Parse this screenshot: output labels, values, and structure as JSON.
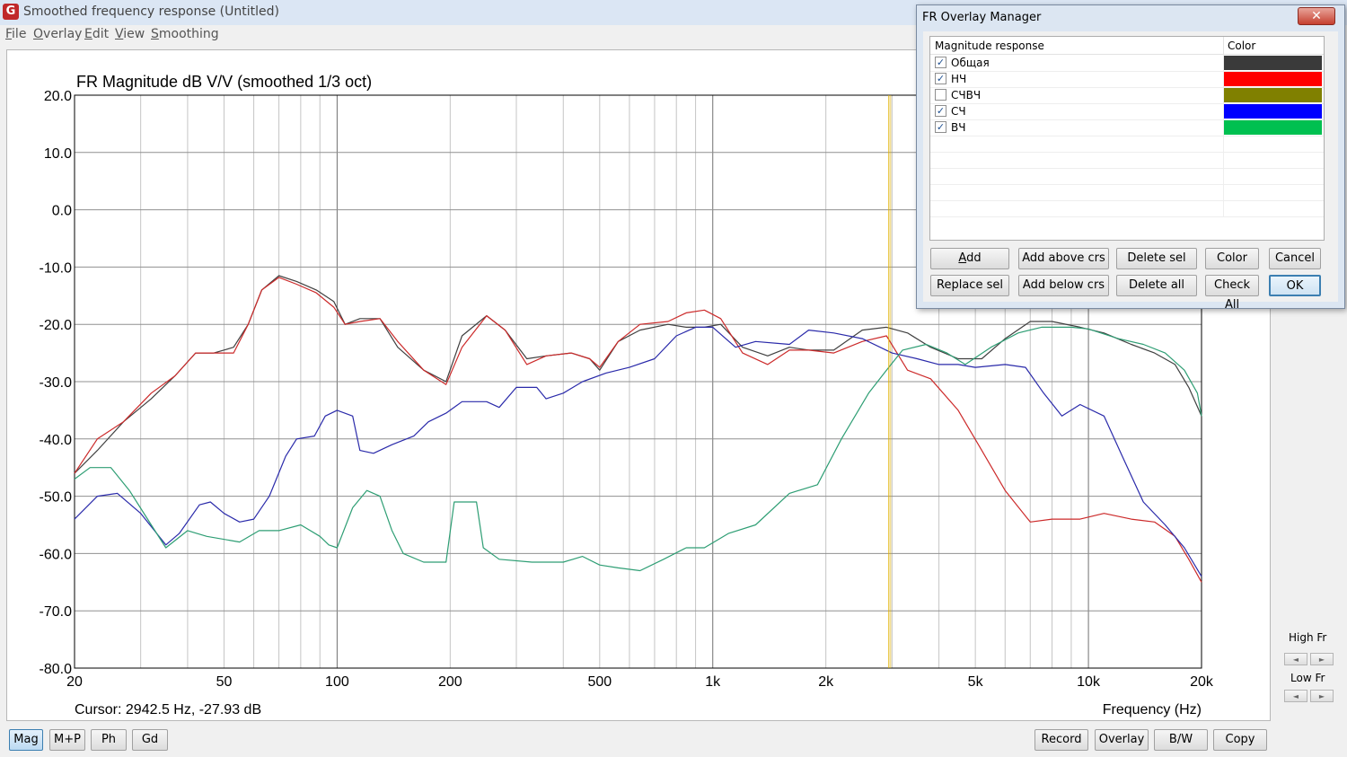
{
  "window": {
    "title": "Smoothed frequency response (Untitled)",
    "icon": "app-logo-icon"
  },
  "menu": [
    {
      "label": "File",
      "key": "F",
      "rest": "ile"
    },
    {
      "label": "Overlay",
      "key": "O",
      "rest": "verlay"
    },
    {
      "label": "Edit",
      "key": "E",
      "rest": "dit"
    },
    {
      "label": "View",
      "key": "V",
      "rest": "iew"
    },
    {
      "label": "Smoothing",
      "key": "S",
      "rest": "moothing"
    }
  ],
  "chart_data": {
    "type": "line",
    "title": "FR Magnitude dB V/V (smoothed 1/3 oct)",
    "xlabel": "Frequency (Hz)",
    "ylabel": "",
    "xscale": "log",
    "xlim": [
      20,
      20000
    ],
    "ylim": [
      -80,
      20
    ],
    "grid": true,
    "x_ticks": [
      20,
      50,
      100,
      200,
      500,
      1000,
      2000,
      5000,
      10000,
      20000
    ],
    "x_tick_labels": [
      "20",
      "50",
      "100",
      "200",
      "500",
      "1k",
      "2k",
      "5k",
      "10k",
      "20k"
    ],
    "y_ticks": [
      20,
      10,
      0,
      -10,
      -20,
      -30,
      -40,
      -50,
      -60,
      -70,
      -80
    ],
    "y_tick_labels": [
      "20.0",
      "10.0",
      "0.0",
      "-10.0",
      "-20.0",
      "-30.0",
      "-40.0",
      "-50.0",
      "-60.0",
      "-70.0",
      "-80.0"
    ],
    "cursor": {
      "frequency_hz": 2942.5,
      "label": "Cursor: 2942.5 Hz, -27.93 dB",
      "color": "#e0b000"
    },
    "series": [
      {
        "name": "Общая",
        "color": "#404040",
        "points": [
          [
            20,
            -46
          ],
          [
            23,
            -42
          ],
          [
            27,
            -37
          ],
          [
            32,
            -33
          ],
          [
            37,
            -29
          ],
          [
            42,
            -25
          ],
          [
            47,
            -25
          ],
          [
            53,
            -24
          ],
          [
            58,
            -20
          ],
          [
            63,
            -14
          ],
          [
            70,
            -11.5
          ],
          [
            78,
            -12.5
          ],
          [
            88,
            -14
          ],
          [
            98,
            -16
          ],
          [
            105,
            -20
          ],
          [
            115,
            -19
          ],
          [
            130,
            -19
          ],
          [
            145,
            -24
          ],
          [
            170,
            -28
          ],
          [
            195,
            -30
          ],
          [
            215,
            -22
          ],
          [
            250,
            -18.5
          ],
          [
            280,
            -21
          ],
          [
            320,
            -26
          ],
          [
            360,
            -25.5
          ],
          [
            420,
            -25
          ],
          [
            470,
            -26
          ],
          [
            500,
            -28
          ],
          [
            560,
            -23
          ],
          [
            640,
            -21
          ],
          [
            760,
            -20
          ],
          [
            850,
            -20.5
          ],
          [
            950,
            -20.5
          ],
          [
            1050,
            -20
          ],
          [
            1200,
            -24
          ],
          [
            1400,
            -25.5
          ],
          [
            1600,
            -24
          ],
          [
            1800,
            -24.5
          ],
          [
            2100,
            -24.5
          ],
          [
            2500,
            -21
          ],
          [
            2900,
            -20.5
          ],
          [
            3300,
            -21.5
          ],
          [
            3800,
            -24
          ],
          [
            4500,
            -26
          ],
          [
            5200,
            -26
          ],
          [
            6000,
            -22.5
          ],
          [
            7000,
            -19.5
          ],
          [
            8000,
            -19.5
          ],
          [
            9500,
            -20.5
          ],
          [
            11000,
            -21.5
          ],
          [
            13000,
            -23.5
          ],
          [
            15000,
            -25
          ],
          [
            17000,
            -27
          ],
          [
            18500,
            -31
          ],
          [
            20000,
            -36
          ]
        ]
      },
      {
        "name": "НЧ",
        "color": "#cc2a2a",
        "points": [
          [
            20,
            -46
          ],
          [
            23,
            -40
          ],
          [
            27,
            -37
          ],
          [
            32,
            -32
          ],
          [
            37,
            -29
          ],
          [
            42,
            -25
          ],
          [
            47,
            -25
          ],
          [
            53,
            -25
          ],
          [
            58,
            -20
          ],
          [
            63,
            -14
          ],
          [
            70,
            -11.8
          ],
          [
            78,
            -13
          ],
          [
            88,
            -14.5
          ],
          [
            98,
            -17
          ],
          [
            105,
            -20
          ],
          [
            115,
            -19.5
          ],
          [
            130,
            -19
          ],
          [
            145,
            -23
          ],
          [
            170,
            -28
          ],
          [
            195,
            -30.5
          ],
          [
            215,
            -24
          ],
          [
            250,
            -18.5
          ],
          [
            280,
            -21
          ],
          [
            320,
            -27
          ],
          [
            360,
            -25.5
          ],
          [
            420,
            -25
          ],
          [
            470,
            -26
          ],
          [
            500,
            -27.5
          ],
          [
            560,
            -23
          ],
          [
            640,
            -20
          ],
          [
            760,
            -19.5
          ],
          [
            850,
            -18
          ],
          [
            950,
            -17.5
          ],
          [
            1050,
            -19
          ],
          [
            1200,
            -25
          ],
          [
            1400,
            -27
          ],
          [
            1600,
            -24.5
          ],
          [
            1800,
            -24.5
          ],
          [
            2100,
            -25
          ],
          [
            2500,
            -23
          ],
          [
            2900,
            -22
          ],
          [
            3300,
            -28
          ],
          [
            3800,
            -29.5
          ],
          [
            4500,
            -35
          ],
          [
            5200,
            -42
          ],
          [
            6000,
            -49
          ],
          [
            7000,
            -54.5
          ],
          [
            8000,
            -54
          ],
          [
            9500,
            -54
          ],
          [
            11000,
            -53
          ],
          [
            13000,
            -54
          ],
          [
            15000,
            -54.5
          ],
          [
            17000,
            -57
          ],
          [
            18500,
            -61
          ],
          [
            20000,
            -65
          ]
        ]
      },
      {
        "name": "СЧ",
        "color": "#2a2aaa",
        "points": [
          [
            20,
            -54
          ],
          [
            23,
            -50
          ],
          [
            26,
            -49.5
          ],
          [
            30,
            -53
          ],
          [
            35,
            -58.5
          ],
          [
            38,
            -56.5
          ],
          [
            43,
            -51.5
          ],
          [
            46,
            -51
          ],
          [
            50,
            -53
          ],
          [
            55,
            -54.5
          ],
          [
            60,
            -54
          ],
          [
            66,
            -50
          ],
          [
            73,
            -43
          ],
          [
            78,
            -40
          ],
          [
            87,
            -39.5
          ],
          [
            93,
            -36
          ],
          [
            100,
            -35
          ],
          [
            110,
            -36
          ],
          [
            115,
            -42
          ],
          [
            125,
            -42.5
          ],
          [
            140,
            -41
          ],
          [
            160,
            -39.5
          ],
          [
            175,
            -37
          ],
          [
            195,
            -35.5
          ],
          [
            215,
            -33.5
          ],
          [
            250,
            -33.5
          ],
          [
            270,
            -34.5
          ],
          [
            300,
            -31
          ],
          [
            340,
            -31
          ],
          [
            360,
            -33
          ],
          [
            400,
            -32
          ],
          [
            450,
            -30
          ],
          [
            520,
            -28.5
          ],
          [
            600,
            -27.5
          ],
          [
            700,
            -26
          ],
          [
            800,
            -22
          ],
          [
            900,
            -20.5
          ],
          [
            1000,
            -20.5
          ],
          [
            1150,
            -24
          ],
          [
            1300,
            -23
          ],
          [
            1600,
            -23.5
          ],
          [
            1800,
            -21
          ],
          [
            2100,
            -21.5
          ],
          [
            2500,
            -22.5
          ],
          [
            3000,
            -25
          ],
          [
            3500,
            -26
          ],
          [
            4000,
            -27
          ],
          [
            4500,
            -27
          ],
          [
            5000,
            -27.5
          ],
          [
            6000,
            -27
          ],
          [
            6800,
            -27.5
          ],
          [
            7600,
            -32
          ],
          [
            8500,
            -36
          ],
          [
            9500,
            -34
          ],
          [
            11000,
            -36
          ],
          [
            12500,
            -44
          ],
          [
            14000,
            -51
          ],
          [
            16000,
            -55
          ],
          [
            18000,
            -59
          ],
          [
            20000,
            -64
          ]
        ]
      },
      {
        "name": "ВЧ",
        "color": "#2e9e74",
        "points": [
          [
            20,
            -47
          ],
          [
            22,
            -45
          ],
          [
            25,
            -45
          ],
          [
            28,
            -49
          ],
          [
            32,
            -55
          ],
          [
            35,
            -59
          ],
          [
            40,
            -56
          ],
          [
            45,
            -57
          ],
          [
            55,
            -58
          ],
          [
            62,
            -56
          ],
          [
            70,
            -56
          ],
          [
            80,
            -55
          ],
          [
            90,
            -57
          ],
          [
            95,
            -58.5
          ],
          [
            100,
            -59
          ],
          [
            110,
            -52
          ],
          [
            120,
            -49
          ],
          [
            130,
            -50
          ],
          [
            140,
            -56
          ],
          [
            150,
            -60
          ],
          [
            170,
            -61.5
          ],
          [
            195,
            -61.5
          ],
          [
            205,
            -51
          ],
          [
            235,
            -51
          ],
          [
            245,
            -59
          ],
          [
            270,
            -61
          ],
          [
            330,
            -61.5
          ],
          [
            400,
            -61.5
          ],
          [
            450,
            -60.5
          ],
          [
            500,
            -62
          ],
          [
            560,
            -62.5
          ],
          [
            640,
            -63
          ],
          [
            740,
            -61
          ],
          [
            850,
            -59
          ],
          [
            950,
            -59
          ],
          [
            1100,
            -56.5
          ],
          [
            1300,
            -55
          ],
          [
            1600,
            -49.5
          ],
          [
            1900,
            -48
          ],
          [
            2200,
            -40
          ],
          [
            2600,
            -32
          ],
          [
            2900,
            -28
          ],
          [
            3200,
            -24.5
          ],
          [
            3700,
            -23.5
          ],
          [
            4200,
            -25
          ],
          [
            4700,
            -27
          ],
          [
            5500,
            -24
          ],
          [
            6500,
            -21.5
          ],
          [
            7500,
            -20.5
          ],
          [
            9000,
            -20.5
          ],
          [
            10000,
            -20.8
          ],
          [
            12000,
            -22.5
          ],
          [
            14000,
            -23.5
          ],
          [
            16000,
            -25
          ],
          [
            18000,
            -28
          ],
          [
            19500,
            -32
          ],
          [
            20000,
            -36
          ]
        ]
      }
    ]
  },
  "cursor_readout": "Cursor: 2942.5 Hz, -27.93 dB",
  "bottom_left_buttons": [
    {
      "label": "Mag",
      "active": true
    },
    {
      "label": "M+P",
      "active": false
    },
    {
      "label": "Ph",
      "active": false
    },
    {
      "label": "Gd",
      "active": false
    }
  ],
  "bottom_right_buttons": [
    "Record",
    "Overlay",
    "B/W",
    "Copy"
  ],
  "side_controls": {
    "high_label": "High Fr",
    "low_label": "Low Fr"
  },
  "overlay_dialog": {
    "title": "FR Overlay Manager",
    "column_name": "Magnitude response",
    "column_color": "Color",
    "rows": [
      {
        "name": "Общая",
        "checked": true,
        "color": "#3a3a3a"
      },
      {
        "name": "НЧ",
        "checked": true,
        "color": "#ff0000"
      },
      {
        "name": "СЧВЧ",
        "checked": false,
        "color": "#808000"
      },
      {
        "name": "СЧ",
        "checked": true,
        "color": "#0000ff"
      },
      {
        "name": "ВЧ",
        "checked": true,
        "color": "#00c050"
      }
    ],
    "buttons_row1": [
      "Add",
      "Add above crs",
      "Delete sel",
      "Color",
      "Cancel"
    ],
    "buttons_row2": [
      "Replace sel",
      "Add below crs",
      "Delete all",
      "Check All",
      "OK"
    ]
  }
}
